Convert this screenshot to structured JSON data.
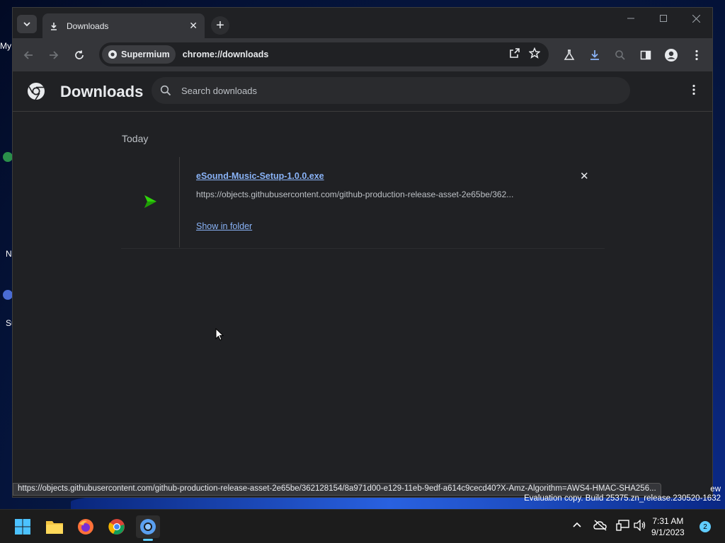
{
  "desktop": {
    "icon_labels": [
      "My",
      "N",
      "Su"
    ]
  },
  "tab": {
    "title": "Downloads"
  },
  "omnibox": {
    "chip_label": "Supermium",
    "url": "chrome://downloads"
  },
  "downloads": {
    "title": "Downloads",
    "search_placeholder": "Search downloads",
    "date_label": "Today",
    "items": [
      {
        "file_name": "eSound-Music-Setup-1.0.0.exe",
        "url": "https://objects.githubusercontent.com/github-production-release-asset-2e65be/362...",
        "action_label": "Show in folder"
      }
    ]
  },
  "status_bar": {
    "url": "https://objects.githubusercontent.com/github-production-release-asset-2e65be/362128154/8a971d00-e129-11eb-9edf-a614c9cecd40?X-Amz-Algorithm=AWS4-HMAC-SHA256..."
  },
  "watermark": {
    "top": "ew",
    "text": "Evaluation copy. Build 25375.zn_release.230520-1632"
  },
  "taskbar": {
    "time": "7:31 AM",
    "date": "9/1/2023",
    "notification_count": "2"
  },
  "colors": {
    "accent_blue": "#8ab4f8",
    "taskbar_accent": "#60cdff",
    "app_icon_green": "#2fd40a"
  }
}
